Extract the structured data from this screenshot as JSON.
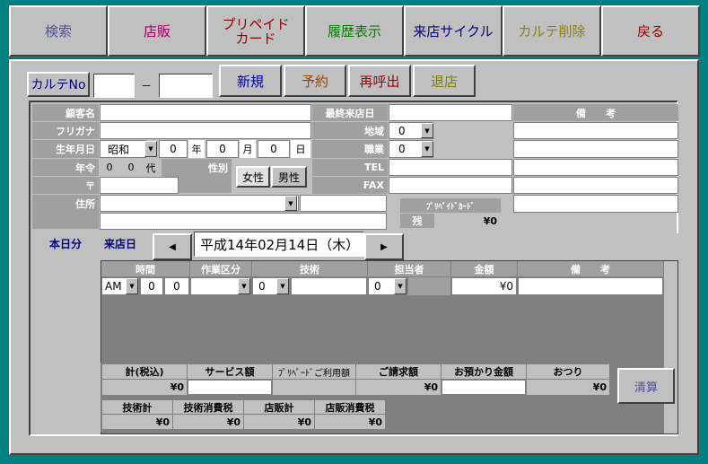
{
  "toolbar": {
    "search": {
      "label": "検索",
      "color": "#50509a"
    },
    "store_sales": {
      "label": "店販",
      "color": "#a00060"
    },
    "prepaid_card": {
      "label": "プリペイド\nカード",
      "color": "#900000"
    },
    "history": {
      "label": "履歴表示",
      "color": "#008000"
    },
    "visit_cycle": {
      "label": "来店サイクル",
      "color": "#000080"
    },
    "delete_chart": {
      "label": "カルテ削除",
      "color": "#908000"
    },
    "back": {
      "label": "戻る",
      "color": "#900000"
    }
  },
  "header": {
    "karte_no_label": "カルテNo",
    "karte_no_sep": "－",
    "new_label": "新規",
    "reserve_label": "予約",
    "recall_label": "再呼出",
    "leave_label": "退店",
    "colors": {
      "new": "#0000a0",
      "reserve": "#a04000",
      "recall": "#a00000",
      "leave": "#808000"
    }
  },
  "customer": {
    "name_label": "顧客名",
    "furigana_label": "フリガナ",
    "birthdate_label": "生年月日",
    "era_value": "昭和",
    "year_value": "0",
    "year_unit": "年",
    "month_value": "0",
    "month_unit": "月",
    "day_value": "0",
    "day_unit": "日",
    "age_label": "年令",
    "age_value1": "0",
    "age_value2": "0",
    "age_unit": "代",
    "gender_label": "性別",
    "female_label": "女性",
    "male_label": "男性",
    "postal_label": "〒",
    "address_label": "住所",
    "last_visit_label": "最終来店日",
    "area_label": "地域",
    "area_value": "0",
    "job_label": "職業",
    "job_value": "0",
    "tel_label": "TEL",
    "fax_label": "FAX",
    "notes_label": "備　　考",
    "prepaid_label": "ﾌﾟﾘﾍﾟｲﾄﾞｶｰﾄﾞ",
    "balance_label": "残",
    "balance_value": "¥0"
  },
  "today": {
    "section_label": "本日分",
    "visit_date_label": "来店日",
    "visit_date_value": "平成14年02月14日（木）",
    "columns": {
      "time": "時間",
      "work": "作業区分",
      "tech": "技術",
      "staff": "担当者",
      "amount": "金額",
      "notes": "備　　考"
    },
    "row": {
      "ampm": "AM",
      "hour": "0",
      "minute": "0",
      "tech_code": "0",
      "staff_code": "0",
      "amount": "¥0"
    }
  },
  "totals": {
    "total_label": "計(税込)",
    "total_value": "¥0",
    "service_label": "サービス額",
    "prepaid_use_label": "ﾌﾟﾘﾍﾟｰﾄﾞご利用額",
    "billing_label": "ご請求額",
    "billing_value": "¥0",
    "deposit_label": "お預かり金額",
    "change_label": "おつり",
    "change_value": "¥0",
    "settle_label": "清算",
    "tech_total_label": "技術計",
    "tech_total_value": "¥0",
    "tech_tax_label": "技術消費税",
    "tech_tax_value": "¥0",
    "store_total_label": "店販計",
    "store_total_value": "¥0",
    "store_tax_label": "店販消費税",
    "store_tax_value": "¥0"
  }
}
